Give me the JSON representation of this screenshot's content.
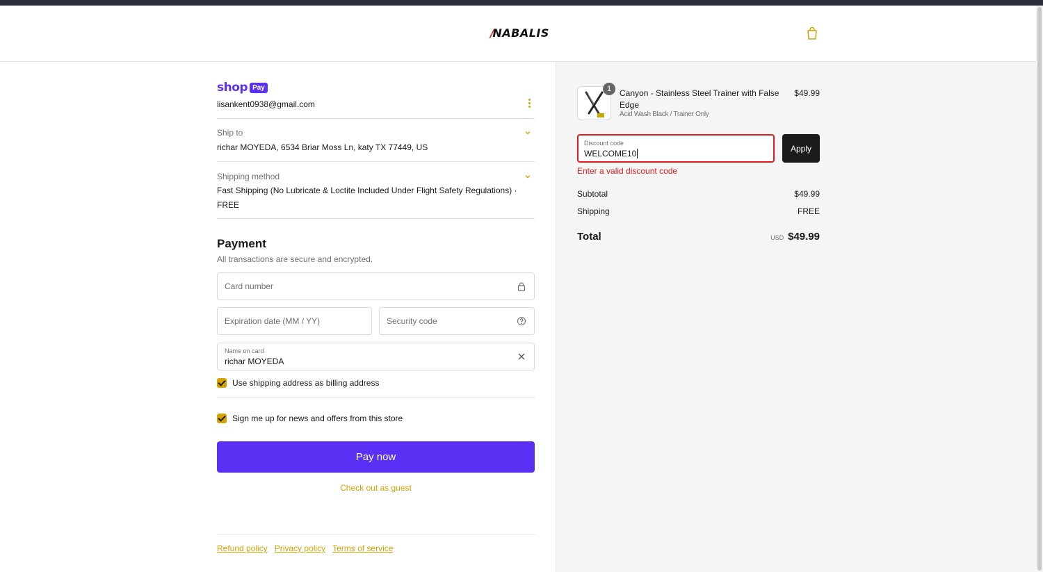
{
  "header": {
    "brand": "NABALIS",
    "cart_icon": "shopping-bag-icon"
  },
  "contact": {
    "shop_word": "shop",
    "pay_badge": "Pay",
    "email": "lisankent0938@gmail.com",
    "menu_icon": "kebab-menu-icon"
  },
  "ship_to": {
    "label": "Ship to",
    "value": "richar MOYEDA, 6534 Briar Moss Ln, katy TX 77449, US"
  },
  "shipping_method": {
    "label": "Shipping method",
    "value": "Fast Shipping (No Lubricate & Loctite Included Under Flight Safety Regulations) · FREE"
  },
  "payment": {
    "title": "Payment",
    "subtitle": "All transactions are secure and encrypted.",
    "card_number_placeholder": "Card number",
    "expiration_placeholder": "Expiration date (MM / YY)",
    "security_placeholder": "Security code",
    "name_label": "Name on card",
    "name_value": "richar MOYEDA",
    "billing_checkbox_label": "Use shipping address as billing address",
    "billing_checked": true,
    "newsletter_label": "Sign me up for news and offers from this store",
    "newsletter_checked": true,
    "pay_button": "Pay now",
    "guest_link": "Check out as guest"
  },
  "footer": {
    "refund": "Refund policy",
    "privacy": "Privacy policy",
    "terms": "Terms of service"
  },
  "order": {
    "item": {
      "quantity": "1",
      "name": "Canyon - Stainless Steel Trainer with False Edge",
      "variant": "Acid Wash Black / Trainer Only",
      "price": "$49.99"
    },
    "discount": {
      "label": "Discount code",
      "value": "WELCOME10",
      "apply_button": "Apply",
      "error": "Enter a valid discount code"
    },
    "subtotal_label": "Subtotal",
    "subtotal_value": "$49.99",
    "shipping_label": "Shipping",
    "shipping_value": "FREE",
    "total_label": "Total",
    "currency": "USD",
    "total_value": "$49.99"
  },
  "colors": {
    "accent": "#d4a300",
    "shop_pay": "#5a31f4",
    "error": "#dd1d1d"
  }
}
